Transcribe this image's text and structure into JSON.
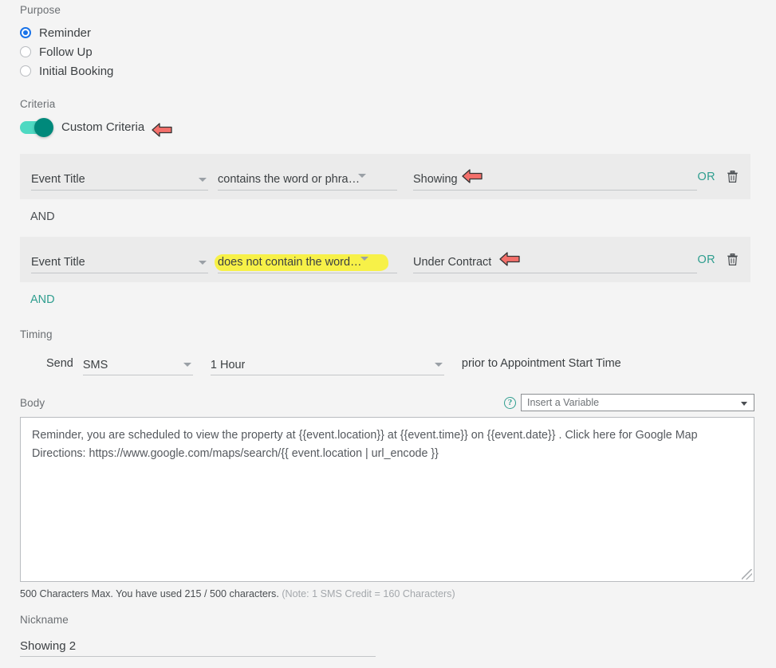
{
  "purpose": {
    "label": "Purpose",
    "options": [
      {
        "label": "Reminder",
        "selected": true
      },
      {
        "label": "Follow Up",
        "selected": false
      },
      {
        "label": "Initial Booking",
        "selected": false
      }
    ]
  },
  "criteria": {
    "label": "Criteria",
    "toggle_label": "Custom Criteria",
    "toggle_on": true,
    "and_static_label": "AND",
    "and_add_label": "AND",
    "rows": [
      {
        "attribute": "Event Title",
        "operator": "contains the word or phra…",
        "value": "Showing",
        "or_label": "OR",
        "delete_icon": "trash-icon",
        "operator_highlighted": false
      },
      {
        "attribute": "Event Title",
        "operator": "does not contain the word…",
        "value": "Under Contract",
        "or_label": "OR",
        "delete_icon": "trash-icon",
        "operator_highlighted": true
      }
    ]
  },
  "timing": {
    "label": "Timing",
    "send_label": "Send",
    "channel": "SMS",
    "lead_time": "1 Hour",
    "suffix": "prior to Appointment Start Time"
  },
  "body": {
    "label": "Body",
    "help_icon": "question-circle-icon",
    "variable_select_value": "Insert a Variable",
    "text": "Reminder, you are scheduled to view the property at {{event.location}} at {{event.time}} on {{event.date}} . Click here for Google Map Directions: https://www.google.com/maps/search/{{ event.location | url_encode }}",
    "char_note_main": "500 Characters Max. You have used 215 / 500 characters.",
    "char_note_dim": "(Note: 1 SMS Credit = 160 Characters)"
  },
  "nickname": {
    "label": "Nickname",
    "value": "Showing 2"
  },
  "annotations": {
    "arrow_icon": "left-arrow-annotation",
    "highlight_color": "#f7f13a",
    "arrow_color": "#f4706b"
  },
  "colors": {
    "accent_teal": "#2f9e8f",
    "radio_blue": "#1a73e8",
    "toggle_track": "#4ed9c2",
    "toggle_knob": "#00897b",
    "page_bg": "#f4f4f4",
    "row_bg": "#ebebeb"
  }
}
